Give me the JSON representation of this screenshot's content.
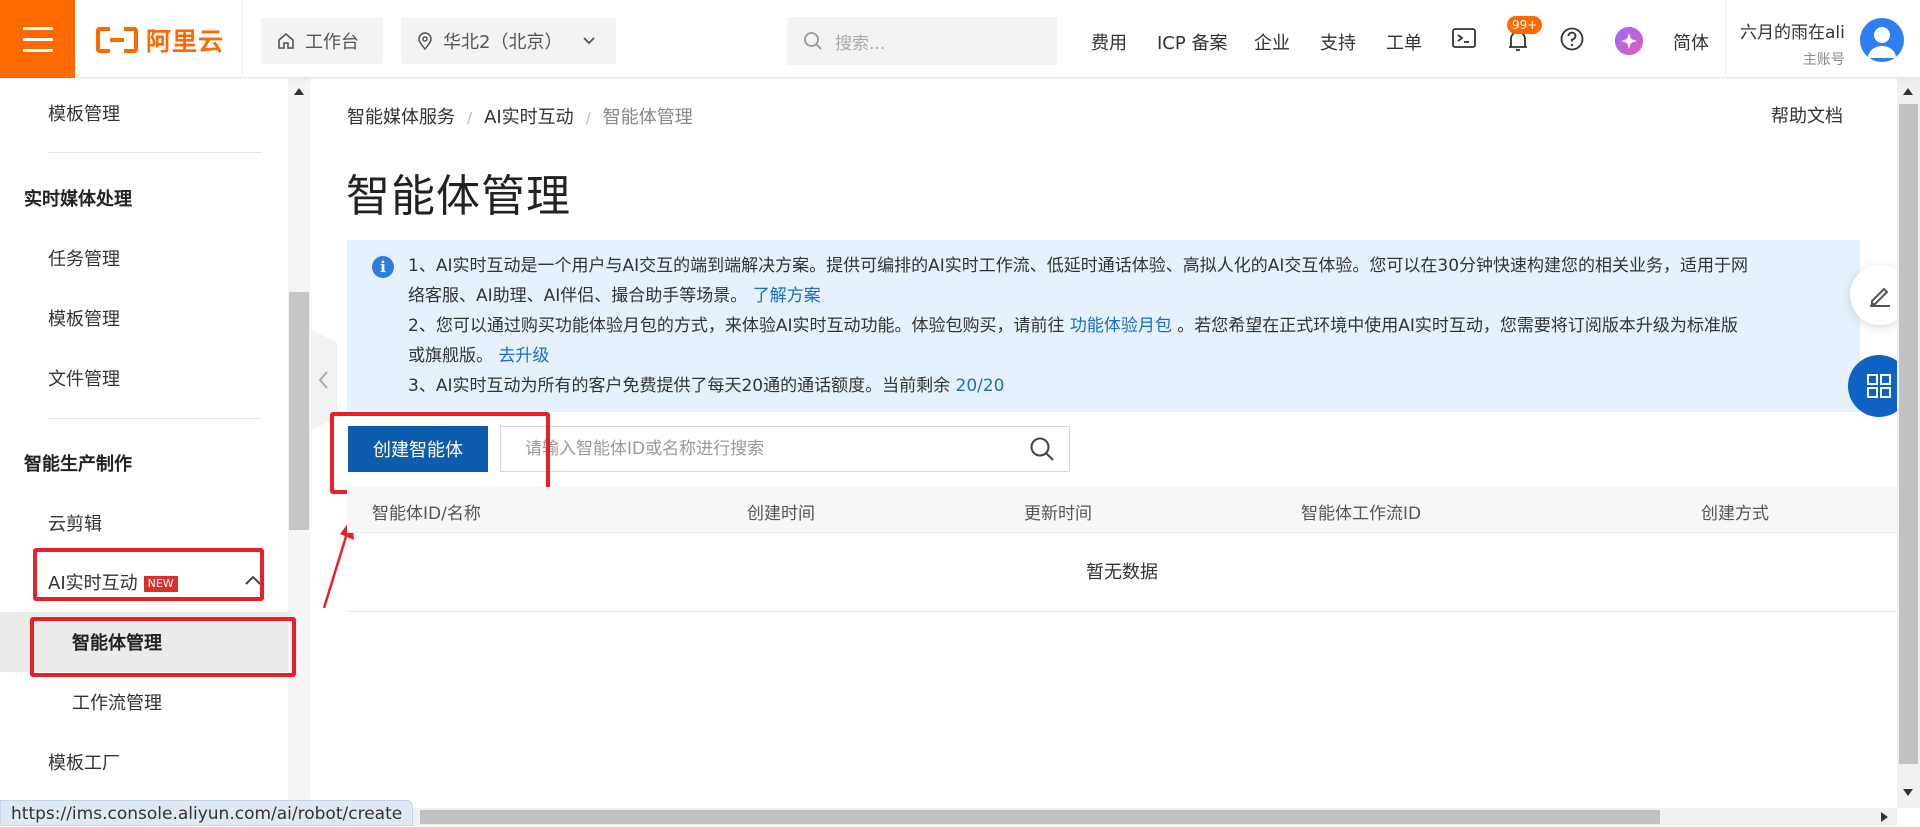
{
  "topbar": {
    "logo_text": "阿里云",
    "workbench": "工作台",
    "region": "华北2（北京）",
    "search_placeholder": "搜索...",
    "nav": [
      "费用",
      "ICP 备案",
      "企业",
      "支持",
      "工单"
    ],
    "notification_count": "99+",
    "language": "简体",
    "user_name": "六月的雨在ali",
    "user_role": "主账号",
    "accent": "#ff6a00"
  },
  "sidebar": {
    "item_template_mgmt_top": "模板管理",
    "section_realtime": "实时媒体处理",
    "item_task_mgmt": "任务管理",
    "item_template_mgmt": "模板管理",
    "item_file_mgmt": "文件管理",
    "section_production": "智能生产制作",
    "item_cloud_edit": "云剪辑",
    "item_ai_interaction": "AI实时互动",
    "new_tag": "NEW",
    "item_agent_mgmt": "智能体管理",
    "item_workflow_mgmt": "工作流管理",
    "item_template_factory": "模板工厂"
  },
  "breadcrumb": [
    "智能媒体服务",
    "AI实时互动",
    "智能体管理"
  ],
  "help_doc": "帮助文档",
  "page_title": "智能体管理",
  "notice": {
    "line1a": "1、AI实时互动是一个用户与AI交互的端到端解决方案。提供可编排的AI实时工作流、低延时通话体验、高拟人化的AI交互体验。您可以在30分钟快速构建您的相关业务，适用于网",
    "line1b": "络客服、AI助理、AI伴侣、撮合助手等场景。",
    "link1": "了解方案",
    "line2a": "2、您可以通过购买功能体验月包的方式，来体验AI实时互动功能。体验包购买，请前往",
    "link2": "功能体验月包",
    "line2b": "。若您希望在正式环境中使用AI实时互动，您需要将订阅版本升级为标准版",
    "line2c": "或旗舰版。",
    "link3": "去升级",
    "line3": "3、AI实时互动为所有的客户免费提供了每天20通的通话额度。当前剩余",
    "remaining": "20/20"
  },
  "create_button": "创建智能体",
  "search": {
    "placeholder": "请输入智能体ID或名称进行搜索",
    "value": ""
  },
  "table": {
    "columns": [
      "智能体ID/名称",
      "创建时间",
      "更新时间",
      "智能体工作流ID",
      "创建方式"
    ],
    "empty_text": "暂无数据"
  },
  "status_url": "https://ims.console.aliyun.com/ai/robot/create"
}
